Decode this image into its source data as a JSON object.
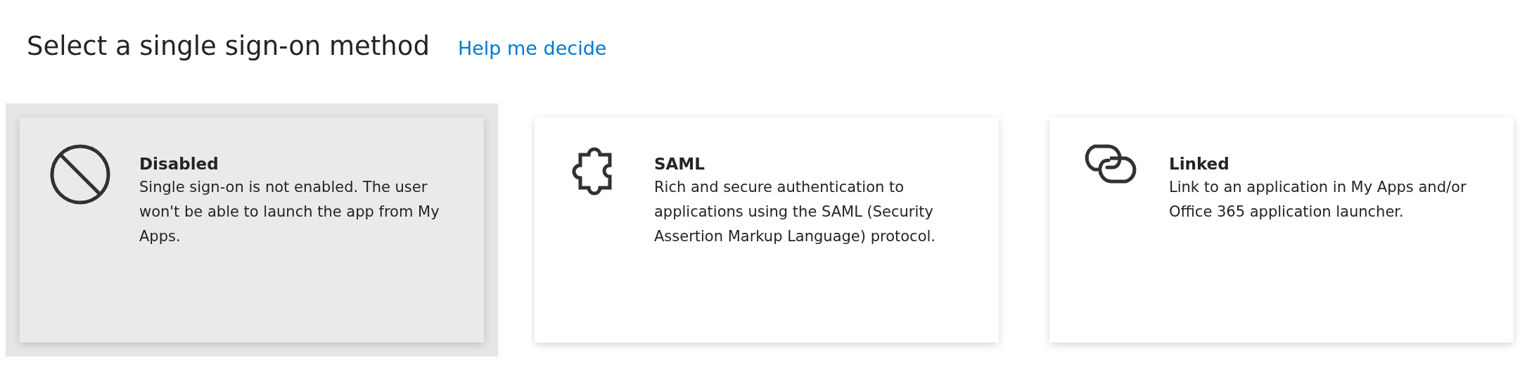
{
  "header": {
    "title": "Select a single sign-on method",
    "help_link": "Help me decide"
  },
  "methods": [
    {
      "kind": "disabled",
      "title": "Disabled",
      "description": "Single sign-on is not enabled. The user won't be able to launch the app from My Apps.",
      "selected": true
    },
    {
      "kind": "saml",
      "title": "SAML",
      "description": "Rich and secure authentication to applications using the SAML (Security Assertion Markup Language) protocol.",
      "selected": false
    },
    {
      "kind": "linked",
      "title": "Linked",
      "description": "Link to an application in My Apps and/or Office 365 application launcher.",
      "selected": false
    }
  ]
}
